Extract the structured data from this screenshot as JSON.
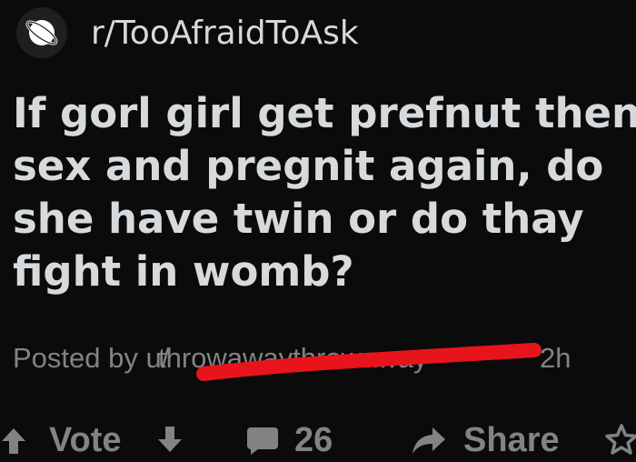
{
  "subreddit": {
    "name": "r/TooAfraidToAsk",
    "icon": "subreddit-planet-icon"
  },
  "post": {
    "title_lines": [
      "If gorl girl get prefnut then",
      "sex and pregnit again, do",
      "she have twin or do thay",
      "fight in womb?"
    ],
    "posted_by_prefix": "Posted by u/",
    "username_redacted": "throwaway (redacted)",
    "age": "2h"
  },
  "actions": {
    "vote_label": "Vote",
    "comment_count": "26",
    "share_label": "Share"
  },
  "colors": {
    "background": "#0b0b0b",
    "text": "#d7dadc",
    "muted": "#818384",
    "redaction": "#e8141c"
  },
  "icons": [
    "upvote-arrow-icon",
    "downvote-arrow-icon",
    "comment-bubble-icon",
    "share-arrow-icon",
    "award-icon"
  ]
}
